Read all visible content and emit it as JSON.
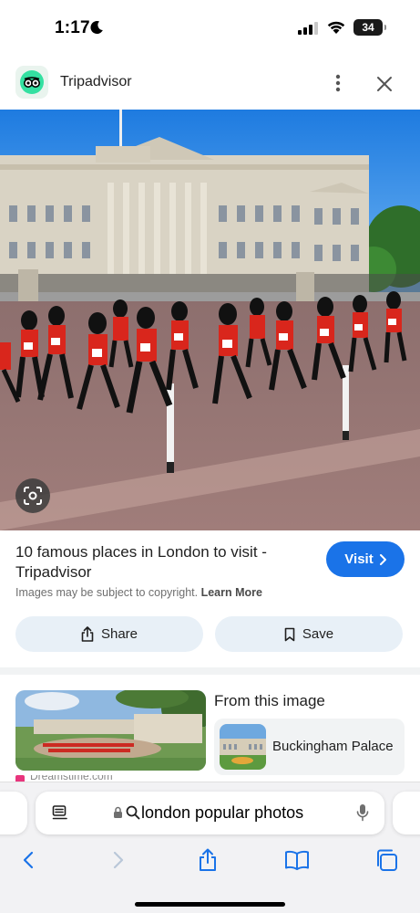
{
  "status": {
    "time": "1:17",
    "battery": "34"
  },
  "header": {
    "site_name": "Tripadvisor"
  },
  "result": {
    "title": "10 famous places in London to visit - Tripadvisor",
    "visit_label": "Visit",
    "copyright_text": "Images may be subject to copyright.",
    "learn_more": "Learn More"
  },
  "actions": {
    "share_label": "Share",
    "save_label": "Save"
  },
  "from_image": {
    "title": "From this image",
    "entity": "Buckingham Palace",
    "source_peek": "Dreamstime.com"
  },
  "browser": {
    "address_text": "london popular photos"
  },
  "colors": {
    "accent": "#1a73e8",
    "chip_bg": "#e8f0f7",
    "tripadvisor_green": "#34e0a1"
  }
}
